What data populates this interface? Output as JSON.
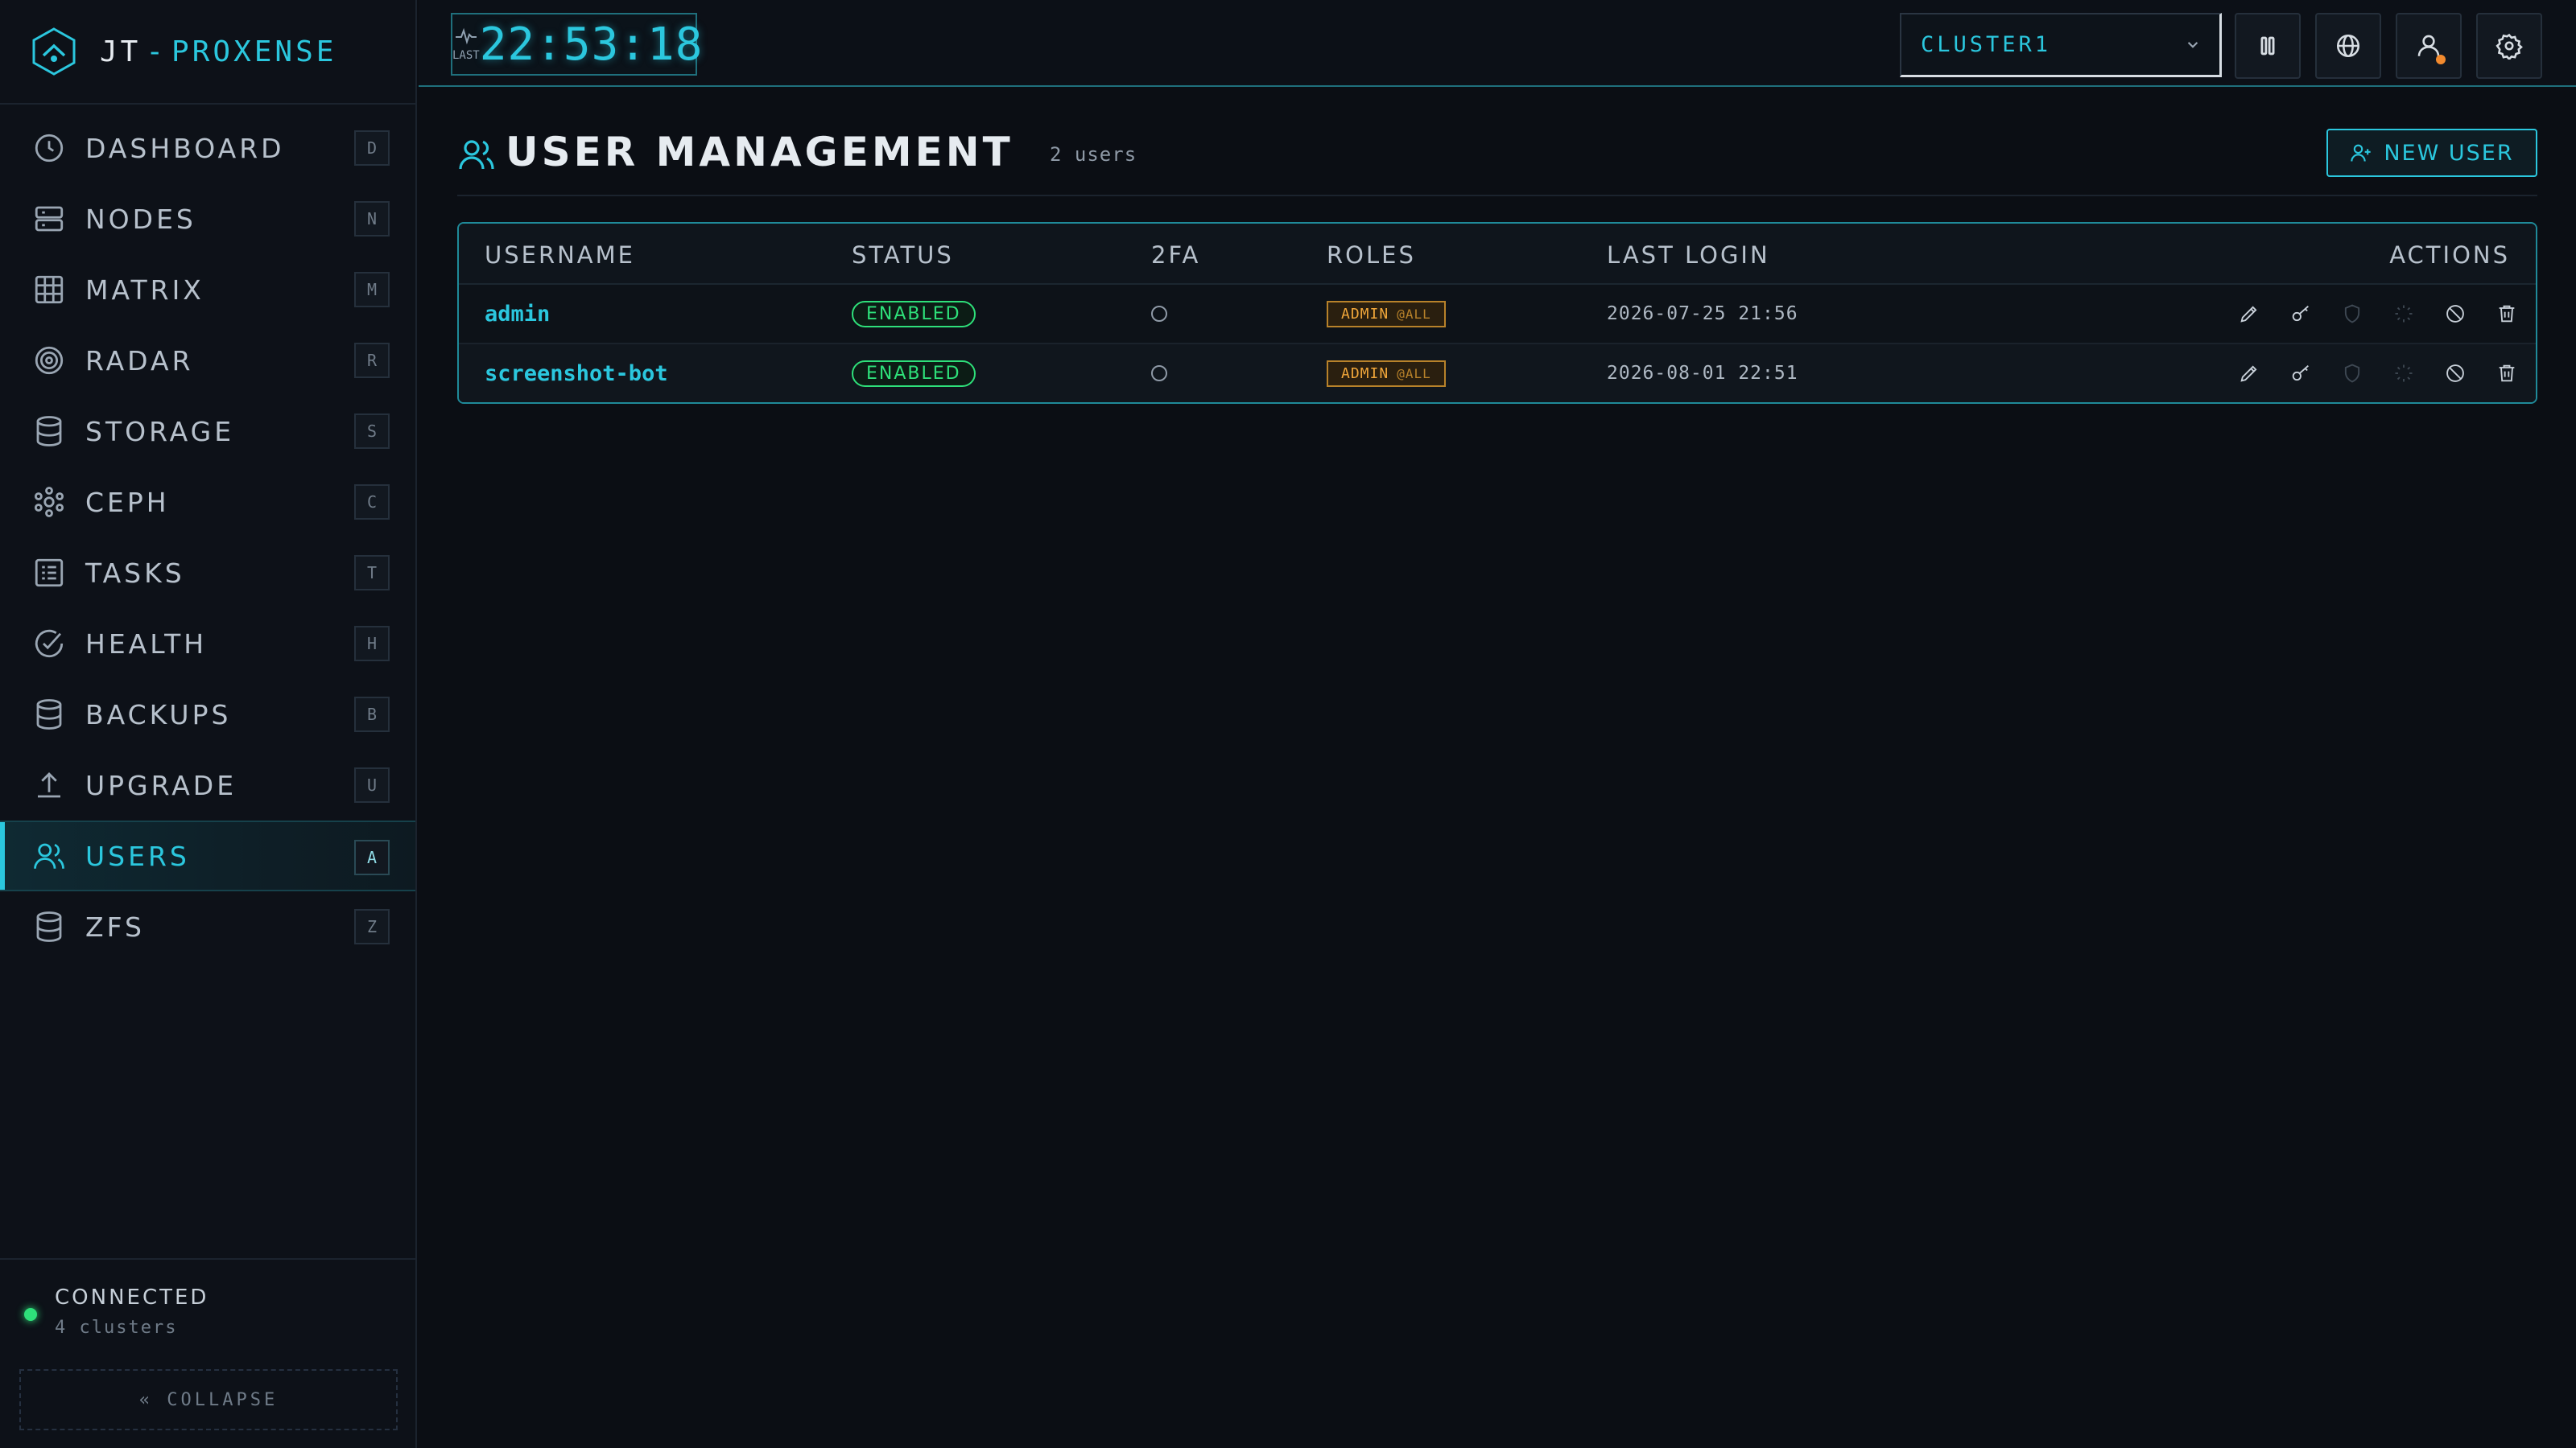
{
  "brand": {
    "prefix": "JT",
    "separator": "-",
    "name": "PROXENSE"
  },
  "nav": [
    {
      "id": "dashboard",
      "label": "DASHBOARD",
      "key": "D",
      "icon": "clock-icon"
    },
    {
      "id": "nodes",
      "label": "NODES",
      "key": "N",
      "icon": "server-icon"
    },
    {
      "id": "matrix",
      "label": "MATRIX",
      "key": "M",
      "icon": "grid-icon"
    },
    {
      "id": "radar",
      "label": "RADAR",
      "key": "R",
      "icon": "radar-icon"
    },
    {
      "id": "storage",
      "label": "STORAGE",
      "key": "S",
      "icon": "database-icon"
    },
    {
      "id": "ceph",
      "label": "CEPH",
      "key": "C",
      "icon": "ceph-icon"
    },
    {
      "id": "tasks",
      "label": "TASKS",
      "key": "T",
      "icon": "tasks-icon"
    },
    {
      "id": "health",
      "label": "HEALTH",
      "key": "H",
      "icon": "check-circle-icon"
    },
    {
      "id": "backups",
      "label": "BACKUPS",
      "key": "B",
      "icon": "database-icon"
    },
    {
      "id": "upgrade",
      "label": "UPGRADE",
      "key": "U",
      "icon": "upload-icon"
    },
    {
      "id": "users",
      "label": "USERS",
      "key": "A",
      "icon": "users-icon",
      "active": true
    },
    {
      "id": "zfs",
      "label": "ZFS",
      "key": "Z",
      "icon": "database-icon"
    }
  ],
  "footer": {
    "status": "CONNECTED",
    "clusters": "4 clusters",
    "collapse_label": "« COLLAPSE"
  },
  "topbar": {
    "clock_label": "LAST",
    "clock_time": "22:53:18",
    "cluster": "CLUSTER1"
  },
  "page": {
    "title": "USER MANAGEMENT",
    "count": "2 users",
    "new_user_label": "NEW USER"
  },
  "table": {
    "headers": {
      "username": "USERNAME",
      "status": "STATUS",
      "twofa": "2FA",
      "roles": "ROLES",
      "last_login": "LAST LOGIN",
      "actions": "ACTIONS"
    },
    "rows": [
      {
        "username": "admin",
        "status": "ENABLED",
        "role": "ADMIN",
        "scope": "@ALL",
        "last_login": "2026-07-25 21:56"
      },
      {
        "username": "screenshot-bot",
        "status": "ENABLED",
        "role": "ADMIN",
        "scope": "@ALL",
        "last_login": "2026-08-01 22:51"
      }
    ]
  },
  "colors": {
    "accent": "#2bc7de",
    "success": "#2ee07a",
    "warning": "#f0a63a",
    "notification": "#f28a2e",
    "background": "#0b0e14"
  }
}
